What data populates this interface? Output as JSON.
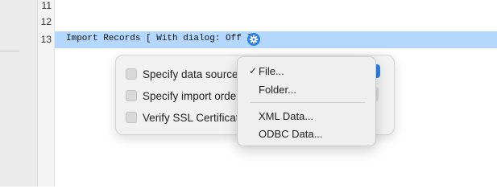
{
  "editor": {
    "line_numbers": [
      "11",
      "12",
      "13"
    ],
    "step_text": "Import Records [ With dialog: Off ]"
  },
  "options": {
    "specify_data_source": "Specify data source",
    "specify_import_order": "Specify import order",
    "verify_ssl": "Verify SSL Certificates"
  },
  "data_source_menu": {
    "items": [
      {
        "label": "File...",
        "checked": true,
        "check_mark": "✓"
      },
      {
        "label": "Folder...",
        "checked": false,
        "check_mark": ""
      },
      {
        "label": "XML Data...",
        "checked": false,
        "check_mark": ""
      },
      {
        "label": "ODBC Data...",
        "checked": false,
        "check_mark": ""
      }
    ]
  },
  "colors": {
    "selected_line": "#b3d7ff",
    "accent": "#2f7fe0"
  }
}
